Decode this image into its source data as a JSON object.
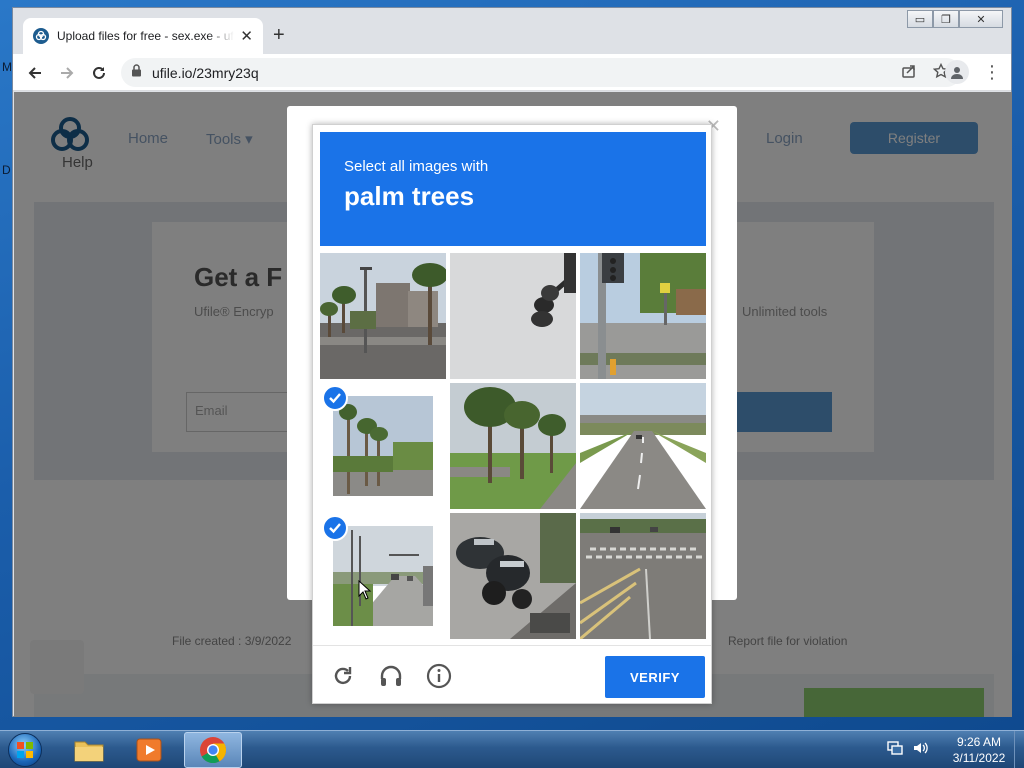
{
  "browser": {
    "tab_title": "Upload files for free - sex.exe - ufile.io",
    "url": "ufile.io/23mry23q"
  },
  "desktop": {
    "left_letter_1": "M",
    "left_letter_2": "D"
  },
  "page": {
    "help_label": "Help",
    "nav_home": "Home",
    "nav_tools": "Tools ▾",
    "nav_login": "Login",
    "register_label": "Register",
    "headline": "Get a F",
    "sub_left": "Ufile® Encryp",
    "sub_right": "Unlimited tools",
    "field_placeholder": "Email",
    "file_created": "File created : 3/9/2022",
    "report_link": "Report file for violation"
  },
  "captcha": {
    "instruction_line1": "Select all images with",
    "instruction_target": "palm trees",
    "verify_label": "VERIFY",
    "tiles": [
      {
        "desc": "street with palm trees",
        "selected": false
      },
      {
        "desc": "street lamp closeup",
        "selected": false
      },
      {
        "desc": "traffic light at intersection",
        "selected": false
      },
      {
        "desc": "road with palm trees",
        "selected": true
      },
      {
        "desc": "palm trees in median",
        "selected": false
      },
      {
        "desc": "highway overpass",
        "selected": false
      },
      {
        "desc": "intersection street",
        "selected": true
      },
      {
        "desc": "parked motorcycles",
        "selected": false
      },
      {
        "desc": "crosswalk road",
        "selected": false
      }
    ]
  },
  "taskbar": {
    "apps": [
      "windows-explorer",
      "media-player",
      "google-chrome"
    ],
    "time": "9:26 AM",
    "date": "3/11/2022"
  },
  "colors": {
    "captcha_blue": "#1a73e8",
    "check_blue": "#1a73e8"
  }
}
